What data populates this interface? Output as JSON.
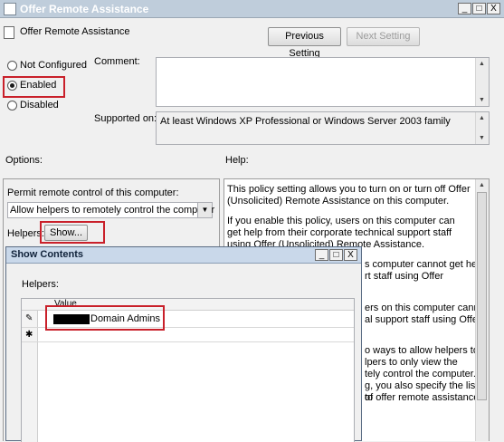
{
  "window": {
    "title": "Offer Remote Assistance",
    "controls": [
      "_",
      "□",
      "X"
    ]
  },
  "header": {
    "policy_name": "Offer Remote Assistance",
    "prev_button": "Previous Setting",
    "next_button": "Next Setting"
  },
  "state": {
    "options": [
      {
        "label": "Not Configured",
        "checked": false
      },
      {
        "label": "Enabled",
        "checked": true
      },
      {
        "label": "Disabled",
        "checked": false
      }
    ]
  },
  "comment": {
    "label": "Comment:",
    "value": ""
  },
  "supported": {
    "label": "Supported on:",
    "value": "At least Windows XP Professional or Windows Server 2003 family"
  },
  "options_section": {
    "label": "Options:",
    "permit_label": "Permit remote control of this computer:",
    "permit_value": "Allow helpers to remotely control the computer",
    "helpers_label": "Helpers:",
    "show_button": "Show..."
  },
  "help_section": {
    "label": "Help:",
    "paragraphs": [
      "This policy setting allows you to turn on or turn off Offer (Unsolicited) Remote Assistance on this computer.",
      "If you enable this policy, users on this computer can get help from their corporate technical support staff using Offer (Unsolicited) Remote Assistance."
    ],
    "fragments": [
      "s computer cannot get help",
      "rt staff using Offer",
      "ers on this computer cannot",
      "al support staff using Offer",
      "o ways to allow helpers to",
      "lpers to only view the",
      "tely control the computer.\"",
      "g, you also specify the list of",
      "to offer remote assistance."
    ]
  },
  "dialog": {
    "title": "Show Contents",
    "controls": [
      "_",
      "□",
      "X"
    ],
    "helpers_label": "Helpers:",
    "column_header": "Value",
    "rows": [
      {
        "marker": "✎",
        "value": "Domain Admins"
      },
      {
        "marker": "✱",
        "value": ""
      }
    ]
  },
  "colors": {
    "highlight": "#c9202a",
    "title_bar": "#bfcddb"
  }
}
